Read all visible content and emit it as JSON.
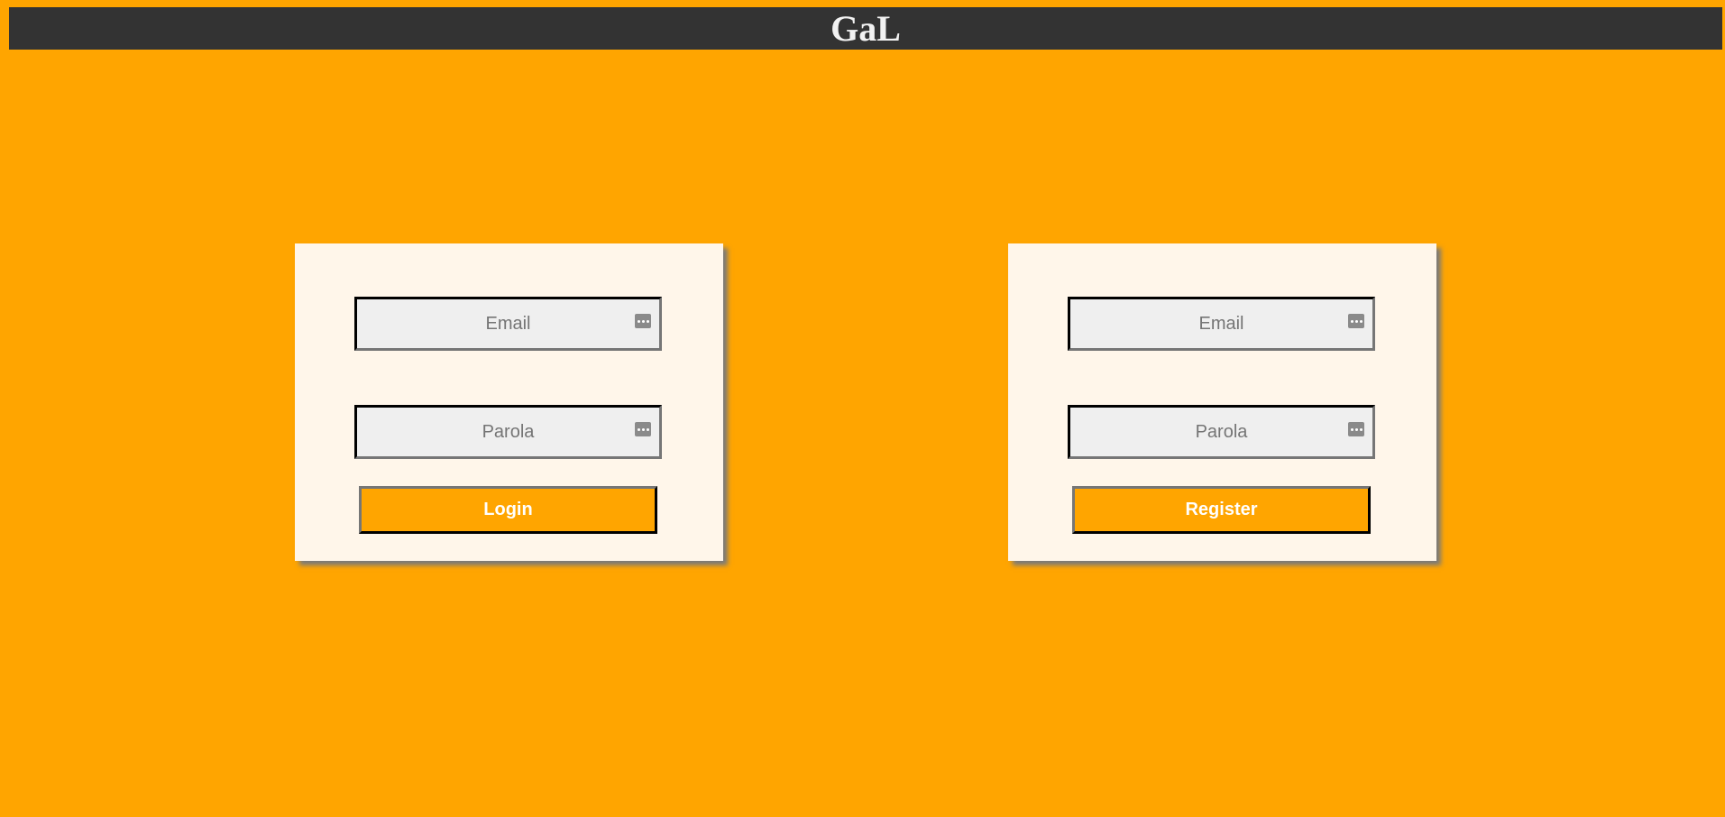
{
  "header": {
    "title": "GaL"
  },
  "login": {
    "email_placeholder": "Email",
    "password_placeholder": "Parola",
    "button_label": "Login"
  },
  "register": {
    "email_placeholder": "Email",
    "password_placeholder": "Parola",
    "button_label": "Register"
  },
  "colors": {
    "page_background": "#ffa500",
    "header_background": "#333333",
    "card_background": "#fff6ea",
    "button_background": "#ffa500"
  },
  "icons": {
    "field_icon": "password-manager-key-icon"
  }
}
